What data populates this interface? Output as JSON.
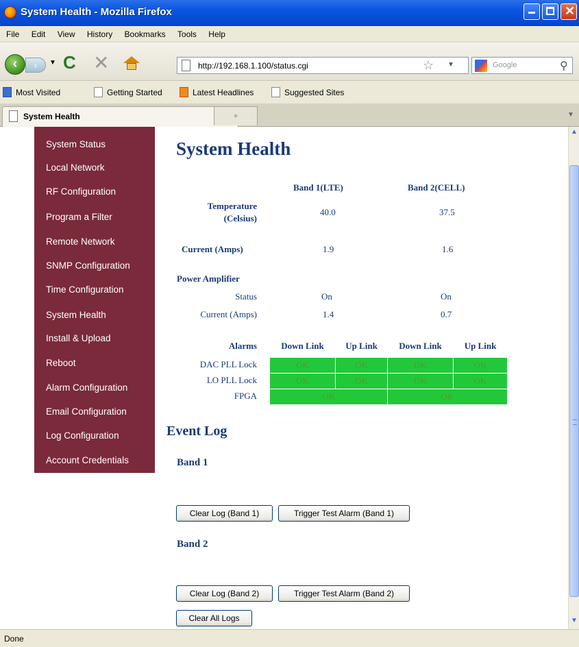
{
  "window": {
    "title": "System Health - Mozilla Firefox"
  },
  "menu": [
    "File",
    "Edit",
    "View",
    "History",
    "Bookmarks",
    "Tools",
    "Help"
  ],
  "toolbar": {
    "url": "http://192.168.1.100/status.cgi",
    "search_placeholder": "Google"
  },
  "bookmarks": [
    "Most Visited",
    "Getting Started",
    "Latest Headlines",
    "Suggested Sites"
  ],
  "tab": {
    "label": "System Health"
  },
  "sidebar": {
    "items": [
      "System Status",
      "Local Network",
      "RF Configuration",
      "Program a Filter",
      "Remote Network",
      "SNMP Configuration",
      "Time Configuration",
      "System Health",
      "Install & Upload",
      "Reboot",
      "Alarm Configuration",
      "Email Configuration",
      "Log Configuration",
      "Account Credentials"
    ]
  },
  "health": {
    "title": "System Health",
    "band1_header": "Band 1(LTE)",
    "band2_header": "Band 2(CELL)",
    "temp_label_1": "Temperature",
    "temp_label_2": "(Celsius)",
    "temp_b1": "40.0",
    "temp_b2": "37.5",
    "current_label": "Current (Amps)",
    "current_b1": "1.9",
    "current_b2": "1.6",
    "pa_label": "Power Amplifier",
    "pa_status_label": "Status",
    "pa_status_b1": "On",
    "pa_status_b2": "On",
    "pa_current_label": "Current (Amps)",
    "pa_current_b1": "1.4",
    "pa_current_b2": "0.7",
    "alarms_label": "Alarms",
    "alarm_headers": [
      "Down Link",
      "Up Link",
      "Down Link",
      "Up Link"
    ],
    "alarm_rows": [
      {
        "label": "DAC PLL Lock",
        "values": [
          "OK",
          "OK",
          "OK",
          "OK"
        ]
      },
      {
        "label": "LO PLL Lock",
        "values": [
          "OK",
          "OK",
          "OK",
          "OK"
        ]
      },
      {
        "label": "FPGA",
        "values": [
          "OK",
          "OK"
        ]
      }
    ],
    "ok_color": "#22c83a"
  },
  "eventlog": {
    "title": "Event Log",
    "band1": "Band 1",
    "band2": "Band 2",
    "clear_b1": "Clear Log (Band 1)",
    "test_b1": "Trigger Test Alarm (Band 1)",
    "clear_b2": "Clear Log (Band 2)",
    "test_b2": "Trigger Test Alarm (Band 2)",
    "clear_all": "Clear All Logs"
  },
  "status": "Done"
}
